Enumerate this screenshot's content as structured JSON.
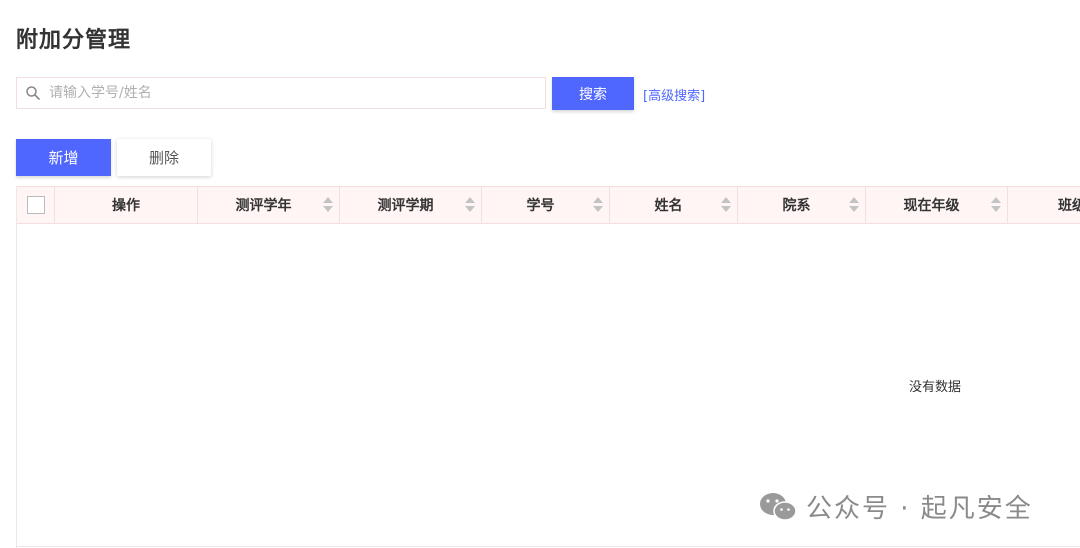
{
  "page": {
    "title": "附加分管理"
  },
  "search": {
    "placeholder": "请输入学号/姓名",
    "button_label": "搜索",
    "advanced_link": "[高级搜索]"
  },
  "toolbar": {
    "add_label": "新增",
    "delete_label": "删除"
  },
  "table": {
    "columns": [
      "操作",
      "测评学年",
      "测评学期",
      "学号",
      "姓名",
      "院系",
      "现在年级",
      "班级"
    ],
    "empty_text": "没有数据"
  },
  "watermark": {
    "text": "公众号 · 起凡安全"
  },
  "colors": {
    "accent": "#4f67ff",
    "header_bg": "#fff5f5"
  }
}
